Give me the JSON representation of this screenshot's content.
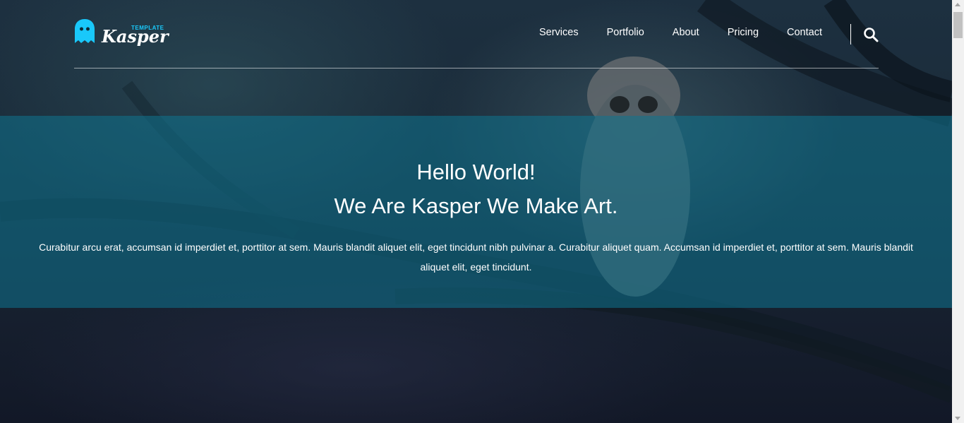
{
  "logo": {
    "small_text": "TEMPLATE",
    "name": "Kasper",
    "accent_color": "#19c8fa"
  },
  "nav": {
    "items": [
      {
        "label": "Services"
      },
      {
        "label": "Portfolio"
      },
      {
        "label": "About"
      },
      {
        "label": "Pricing"
      },
      {
        "label": "Contact"
      }
    ],
    "search_icon": "search-icon"
  },
  "hero": {
    "title_line1": "Hello World!",
    "title_line2": "We Are Kasper We Make Art.",
    "text": "Curabitur arcu erat, accumsan id imperdiet et, porttitor at sem. Mauris blandit aliquet elit, eget tincidunt nibh pulvinar a. Curabitur aliquet quam. Accumsan id imperdiet et, porttitor at sem. Mauris blandit aliquet elit, eget tincidunt.",
    "overlay_color": "#0f748f"
  }
}
